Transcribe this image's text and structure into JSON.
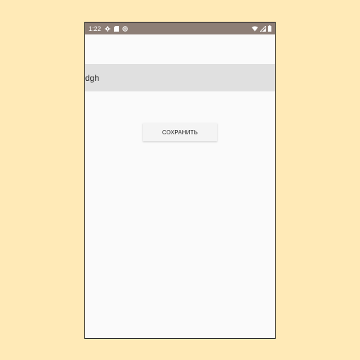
{
  "status_bar": {
    "time": "1:22",
    "icons_left": [
      "gear-icon",
      "sd-card-icon",
      "at-sign-icon"
    ],
    "icons_right": [
      "wifi-icon",
      "signal-icon",
      "battery-icon"
    ]
  },
  "form": {
    "input_value": "dgh",
    "save_label": "СОХРАНИТЬ"
  }
}
